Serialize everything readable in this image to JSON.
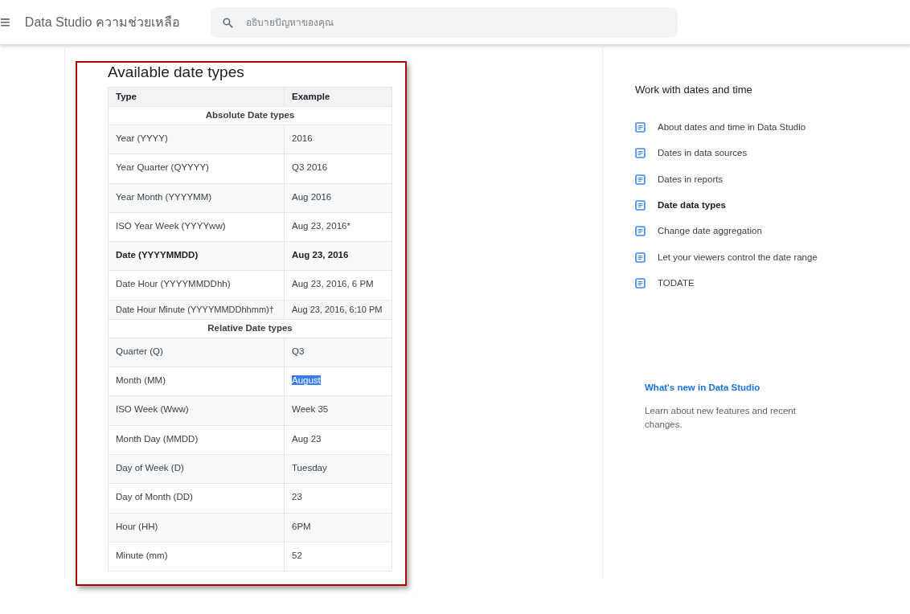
{
  "header": {
    "menu_icon": "≡",
    "title": "Data Studio ความช่วยเหลือ",
    "search": {
      "placeholder": "อธิบายปัญหาของคุณ"
    }
  },
  "article": {
    "heading": "Available date types",
    "table": {
      "columns": [
        "Type",
        "Example"
      ],
      "rows": [
        {
          "kind": "section",
          "label": "Absolute Date types"
        },
        {
          "kind": "row",
          "type": "Year (YYYY)",
          "example": "2016",
          "bold": false,
          "example_selected": false
        },
        {
          "kind": "row",
          "type": "Year Quarter (QYYYY)",
          "example": "Q3 2016",
          "bold": false,
          "example_selected": false
        },
        {
          "kind": "row",
          "type": "Year Month (YYYYMM)",
          "example": "Aug 2016",
          "bold": false,
          "example_selected": false
        },
        {
          "kind": "row",
          "type": "ISO Year Week (YYYYww)",
          "example": "Aug 23, 2016*",
          "bold": false,
          "example_selected": false
        },
        {
          "kind": "row",
          "type": "Date (YYYYMMDD)",
          "example": "Aug 23, 2016",
          "bold": true,
          "example_selected": false
        },
        {
          "kind": "row",
          "type": "Date Hour (YYYYMMDDhh)",
          "example": "Aug 23, 2016, 6 PM",
          "bold": false,
          "example_selected": false
        },
        {
          "kind": "compact",
          "type": "Date Hour Minute (YYYYMMDDhhmm)†",
          "example": "Aug 23, 2016, 6:10 PM",
          "bold": false,
          "example_selected": false
        },
        {
          "kind": "section",
          "label": "Relative Date types"
        },
        {
          "kind": "row",
          "type": "Quarter (Q)",
          "example": "Q3",
          "bold": false,
          "example_selected": false
        },
        {
          "kind": "row",
          "type": "Month (MM)",
          "example": "August",
          "bold": false,
          "example_selected": true
        },
        {
          "kind": "row",
          "type": "ISO Week (Www)",
          "example": "Week 35",
          "bold": false,
          "example_selected": false
        },
        {
          "kind": "row",
          "type": "Month Day (MMDD)",
          "example": "Aug 23",
          "bold": false,
          "example_selected": false
        },
        {
          "kind": "row",
          "type": "Day of Week (D)",
          "example": "Tuesday",
          "bold": false,
          "example_selected": false
        },
        {
          "kind": "row",
          "type": "Day of Month (DD)",
          "example": "23",
          "bold": false,
          "example_selected": false
        },
        {
          "kind": "row",
          "type": "Hour (HH)",
          "example": "6PM",
          "bold": false,
          "example_selected": false
        },
        {
          "kind": "row",
          "type": "Minute (mm)",
          "example": "52",
          "bold": false,
          "example_selected": false
        }
      ]
    }
  },
  "sidebar": {
    "title": "Work with dates and time",
    "items": [
      {
        "label": "About dates and time in Data Studio",
        "selected": false
      },
      {
        "label": "Dates in data sources",
        "selected": false
      },
      {
        "label": "Dates in reports",
        "selected": false
      },
      {
        "label": "Date data types",
        "selected": true
      },
      {
        "label": "Change date aggregation",
        "selected": false
      },
      {
        "label": "Let your viewers control the date range",
        "selected": false
      },
      {
        "label": "TODATE",
        "selected": false
      }
    ],
    "promo": {
      "link": "What's new in Data Studio",
      "text": "Learn about new features and recent changes."
    }
  }
}
